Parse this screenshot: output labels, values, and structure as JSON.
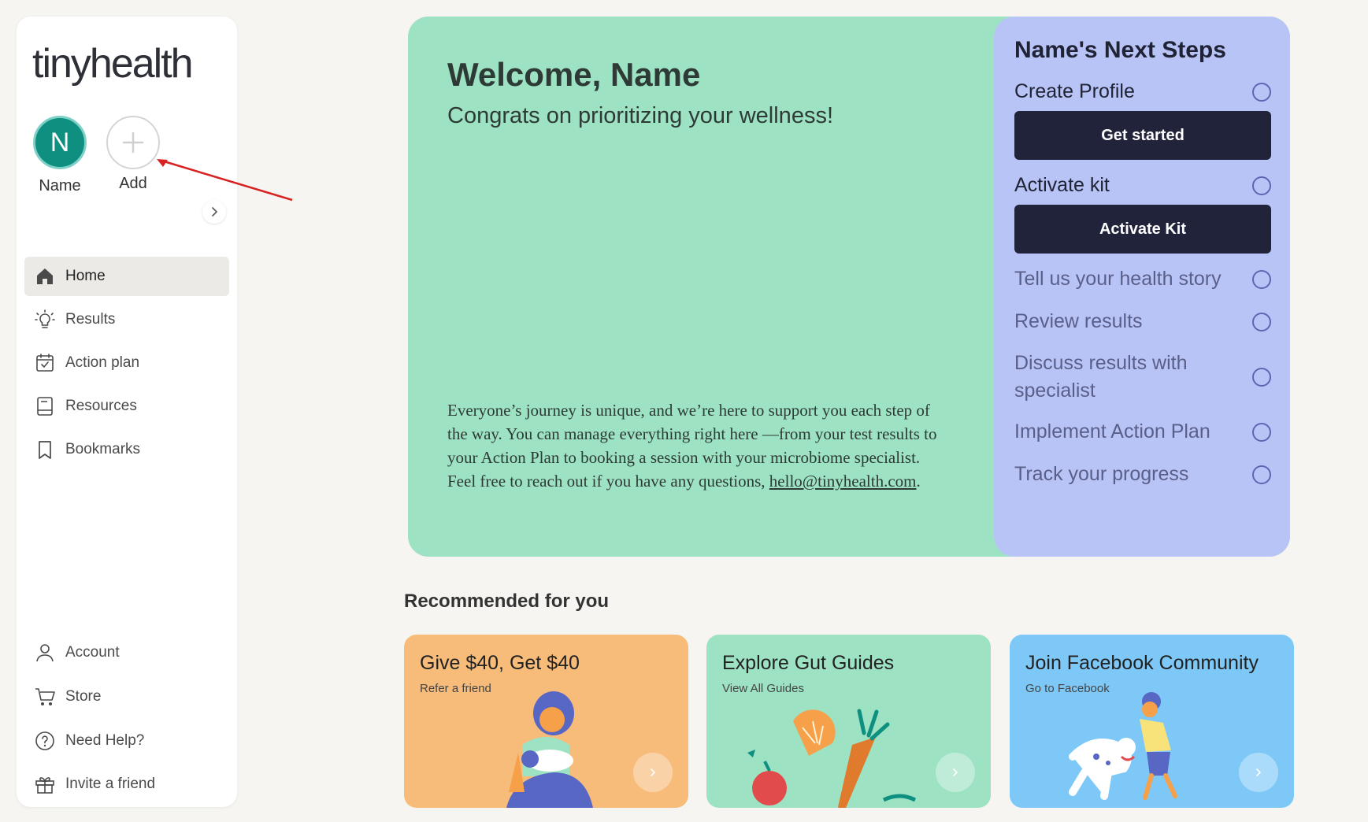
{
  "brand": {
    "logo_text": "tinyhealth"
  },
  "profiles": {
    "current": {
      "initial": "N",
      "label": "Name",
      "color": "#0e8f80"
    },
    "add_label": "Add"
  },
  "nav": {
    "main": [
      {
        "label": "Home",
        "icon": "home-icon",
        "active": true
      },
      {
        "label": "Results",
        "icon": "lightbulb-icon",
        "active": false
      },
      {
        "label": "Action plan",
        "icon": "calendar-check-icon",
        "active": false
      },
      {
        "label": "Resources",
        "icon": "book-icon",
        "active": false
      },
      {
        "label": "Bookmarks",
        "icon": "bookmark-icon",
        "active": false
      }
    ],
    "bottom": [
      {
        "label": "Account",
        "icon": "user-icon"
      },
      {
        "label": "Store",
        "icon": "cart-icon"
      },
      {
        "label": "Need Help?",
        "icon": "help-icon"
      },
      {
        "label": "Invite a friend",
        "icon": "gift-icon"
      }
    ]
  },
  "hero": {
    "title": "Welcome, Name",
    "subtitle": "Congrats on prioritizing your wellness!",
    "body_before_link": "Everyone’s journey is unique, and we’re here to support you each step of the way. You can manage everything right here —from your test results to your Action Plan to booking a session with your microbiome specialist. Feel free to reach out if you have any questions, ",
    "email": "hello@tinyhealth.com",
    "body_after_link": ".",
    "color": "#9de2c3"
  },
  "next_steps": {
    "title": "Name's Next Steps",
    "steps": [
      {
        "label": "Create Profile",
        "button": "Get started",
        "completed": false
      },
      {
        "label": "Activate kit",
        "button": "Activate Kit",
        "completed": false
      },
      {
        "label": "Tell us your health story",
        "completed": false
      },
      {
        "label": "Review results",
        "completed": false
      },
      {
        "label": "Discuss results with specialist",
        "completed": false
      },
      {
        "label": "Implement Action Plan",
        "completed": false
      },
      {
        "label": "Track your progress",
        "completed": false
      }
    ],
    "color": "#b9c4f6"
  },
  "recommended": {
    "title": "Recommended for you",
    "cards": [
      {
        "title": "Give $40, Get $40",
        "subtitle": "Refer a friend",
        "color": "#f7bb7a"
      },
      {
        "title": "Explore Gut Guides",
        "subtitle": "View All Guides",
        "color": "#9de2c3"
      },
      {
        "title": "Join Facebook Community",
        "subtitle": "Go to Facebook",
        "color": "#7ec8f7"
      }
    ]
  }
}
